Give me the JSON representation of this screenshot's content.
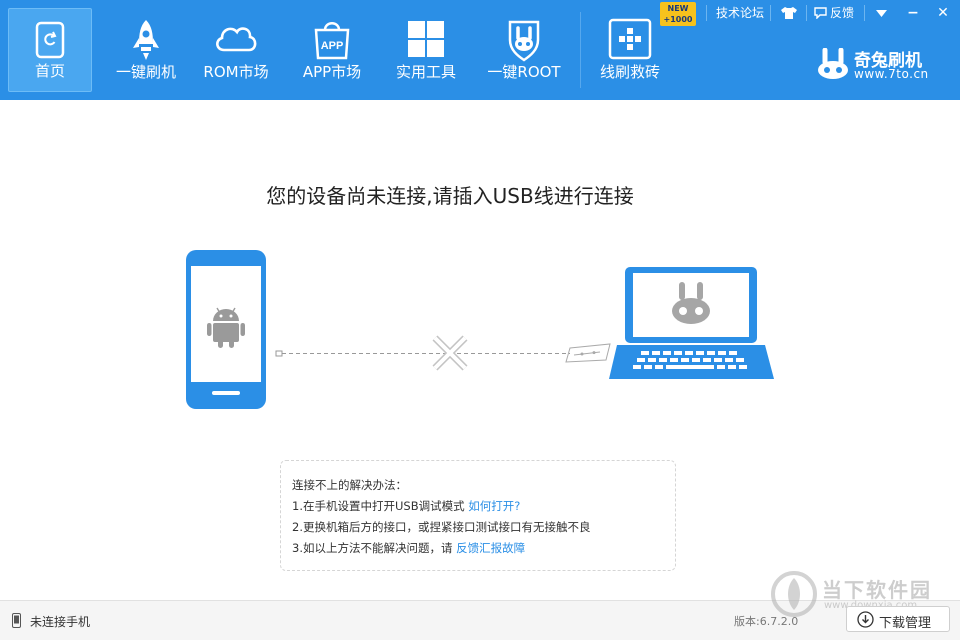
{
  "nav": {
    "items": [
      {
        "label": "首页",
        "icon": "refresh-icon",
        "active": true
      },
      {
        "label": "一键刷机",
        "icon": "rocket-icon"
      },
      {
        "label": "ROM市场",
        "icon": "cloud-icon"
      },
      {
        "label": "APP市场",
        "icon": "app-bag-icon",
        "icon_text": "APP"
      },
      {
        "label": "实用工具",
        "icon": "grid-icon"
      },
      {
        "label": "一键ROOT",
        "icon": "rabbit-shield-icon"
      },
      {
        "label": "线刷救砖",
        "icon": "cross-icon"
      }
    ],
    "new_badge": {
      "line1": "NEW",
      "line2": "+1000"
    }
  },
  "top_links": {
    "forum": "技术论坛",
    "feedback": "反馈"
  },
  "window": {
    "dropdown_icon": "chevron-down-icon",
    "minimize": "−",
    "close": "✕"
  },
  "brand": {
    "name": "奇兔刷机",
    "url": "www.7to.cn"
  },
  "main": {
    "headline": "您的设备尚未连接,请插入USB线进行连接"
  },
  "tips": {
    "title": "连接不上的解决办法：",
    "line1_text": "1.在手机设置中打开USB调试模式 ",
    "line1_link": "如何打开?",
    "line2_text": "2.更换机箱后方的接口，或捏紧接口测试接口有无接触不良",
    "line3_text": "3.如以上方法不能解决问题，请 ",
    "line3_link": "反馈汇报故障"
  },
  "status": {
    "device_status": "未连接手机",
    "version": "版本:6.7.2.0",
    "download_label": "下载管理"
  },
  "watermark": {
    "text": "当下软件园",
    "url": "www.downxia.com"
  },
  "colors": {
    "primary": "#2b8fe6",
    "active_tab": "#4aa7f0",
    "badge": "#f6c21d",
    "link": "#2b8fe6"
  }
}
